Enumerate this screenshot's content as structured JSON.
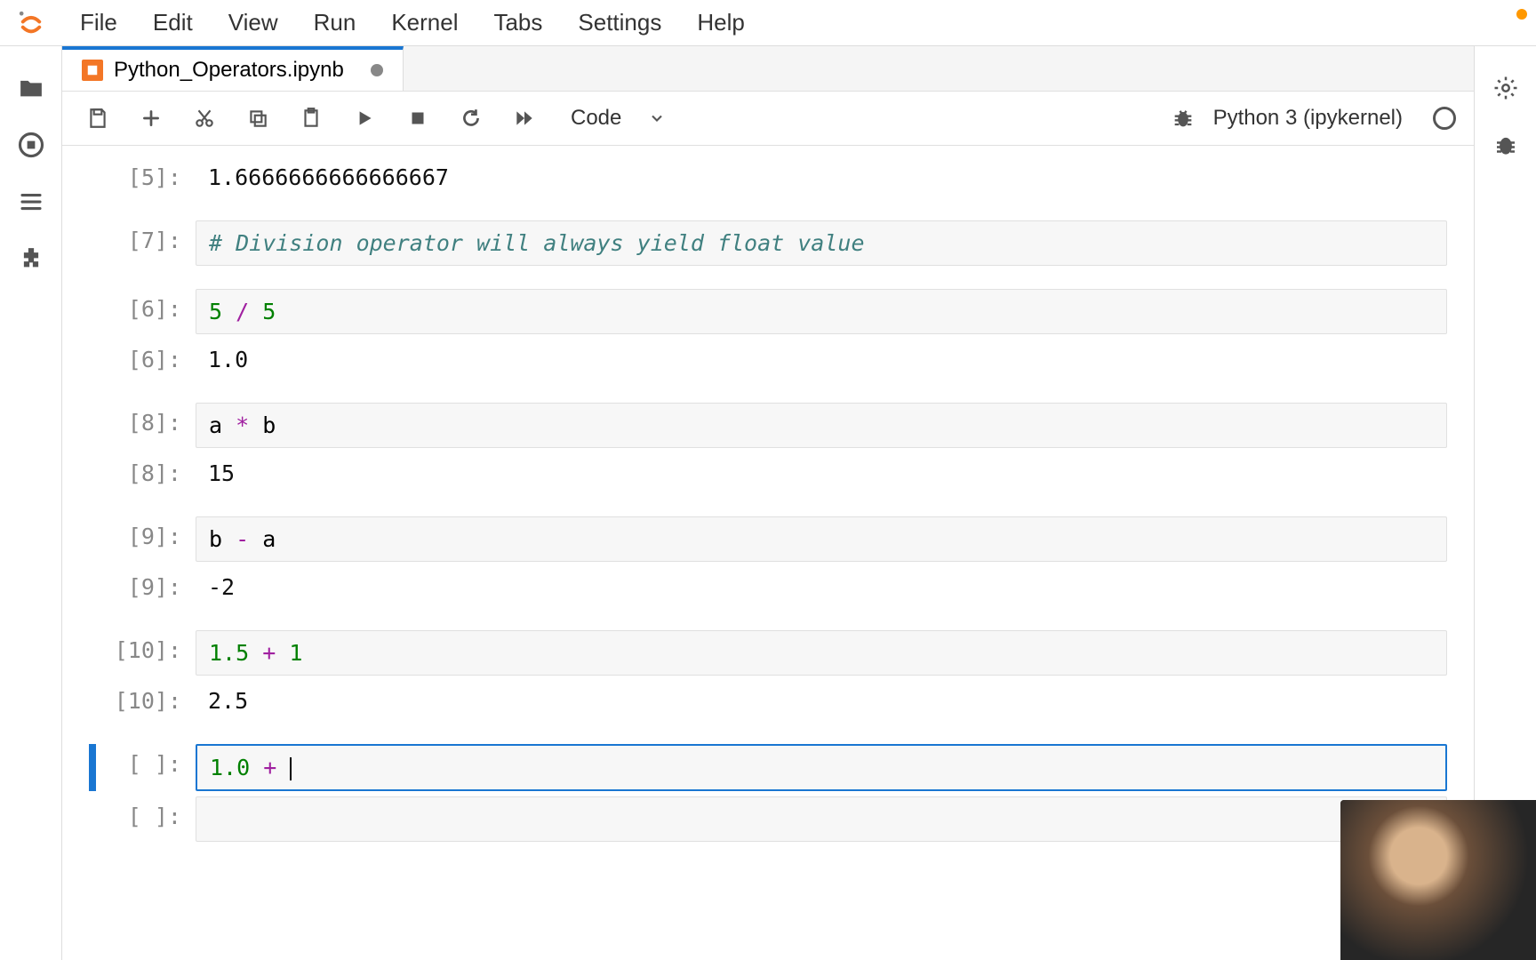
{
  "menubar": [
    "File",
    "Edit",
    "View",
    "Run",
    "Kernel",
    "Tabs",
    "Settings",
    "Help"
  ],
  "tab": {
    "title": "Python_Operators.ipynb",
    "dirty": true
  },
  "toolbar": {
    "cell_type": "Code"
  },
  "kernel": {
    "name": "Python 3 (ipykernel)"
  },
  "cells": [
    {
      "kind": "output",
      "prompt": "[5]:",
      "text": "1.6666666666666667"
    },
    {
      "kind": "code",
      "prompt": "[7]:",
      "tokens": [
        [
          "comment",
          "# Division operator will always yield float value"
        ]
      ]
    },
    {
      "kind": "code",
      "prompt": "[6]:",
      "tokens": [
        [
          "num",
          "5"
        ],
        [
          "plain",
          " "
        ],
        [
          "op",
          "/"
        ],
        [
          "plain",
          " "
        ],
        [
          "num",
          "5"
        ]
      ]
    },
    {
      "kind": "output",
      "prompt": "[6]:",
      "text": "1.0"
    },
    {
      "kind": "code",
      "prompt": "[8]:",
      "tokens": [
        [
          "plain",
          "a "
        ],
        [
          "op",
          "*"
        ],
        [
          "plain",
          " b"
        ]
      ]
    },
    {
      "kind": "output",
      "prompt": "[8]:",
      "text": "15"
    },
    {
      "kind": "code",
      "prompt": "[9]:",
      "tokens": [
        [
          "plain",
          "b "
        ],
        [
          "op",
          "-"
        ],
        [
          "plain",
          " a"
        ]
      ]
    },
    {
      "kind": "output",
      "prompt": "[9]:",
      "text": "-2"
    },
    {
      "kind": "code",
      "prompt": "[10]:",
      "tokens": [
        [
          "num",
          "1.5"
        ],
        [
          "plain",
          " "
        ],
        [
          "op",
          "+"
        ],
        [
          "plain",
          " "
        ],
        [
          "num",
          "1"
        ]
      ]
    },
    {
      "kind": "output",
      "prompt": "[10]:",
      "text": "2.5"
    },
    {
      "kind": "code",
      "prompt": "[ ]:",
      "active": true,
      "tokens": [
        [
          "num",
          "1.0"
        ],
        [
          "plain",
          " "
        ],
        [
          "op",
          "+"
        ],
        [
          "plain",
          " "
        ],
        [
          "cursor",
          ""
        ]
      ]
    },
    {
      "kind": "code",
      "prompt": "[ ]:",
      "tokens": []
    }
  ]
}
